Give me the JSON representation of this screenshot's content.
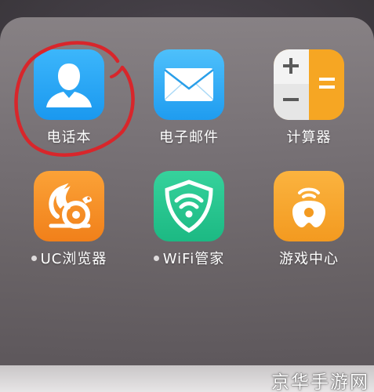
{
  "apps": [
    {
      "label": "电话本",
      "icon": "contacts-icon",
      "color": "#1ea3f4",
      "new_dot": false
    },
    {
      "label": "电子邮件",
      "icon": "mail-icon",
      "color": "#2eaaf6",
      "new_dot": false
    },
    {
      "label": "计算器",
      "icon": "calculator-icon",
      "color": "#f6a623",
      "new_dot": false
    },
    {
      "label": "UC浏览器",
      "icon": "uc-squirrel-icon",
      "color": "#f58a1f",
      "new_dot": true
    },
    {
      "label": "WiFi管家",
      "icon": "wifi-shield-icon",
      "color": "#23c18d",
      "new_dot": true
    },
    {
      "label": "游戏中心",
      "icon": "gamepad-icon",
      "color": "#f6a22b",
      "new_dot": false
    }
  ],
  "watermark": "京华手游网",
  "annotation_color": "#d8262b"
}
